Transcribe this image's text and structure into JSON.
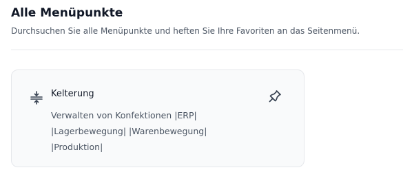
{
  "header": {
    "title": "Alle Menüpunkte",
    "subtitle": "Durchsuchen Sie alle Menüpunkte und heften Sie Ihre Favoriten an das Seitenmenü."
  },
  "card": {
    "icon": "compress-vertical-icon",
    "title": "Kelterung",
    "description_lines": [
      "Verwalten von Konfektionen |ERP|",
      "|Lagerbewegung| |Warenbewegung|",
      "|Produktion|"
    ],
    "pin_icon": "pin-icon"
  }
}
